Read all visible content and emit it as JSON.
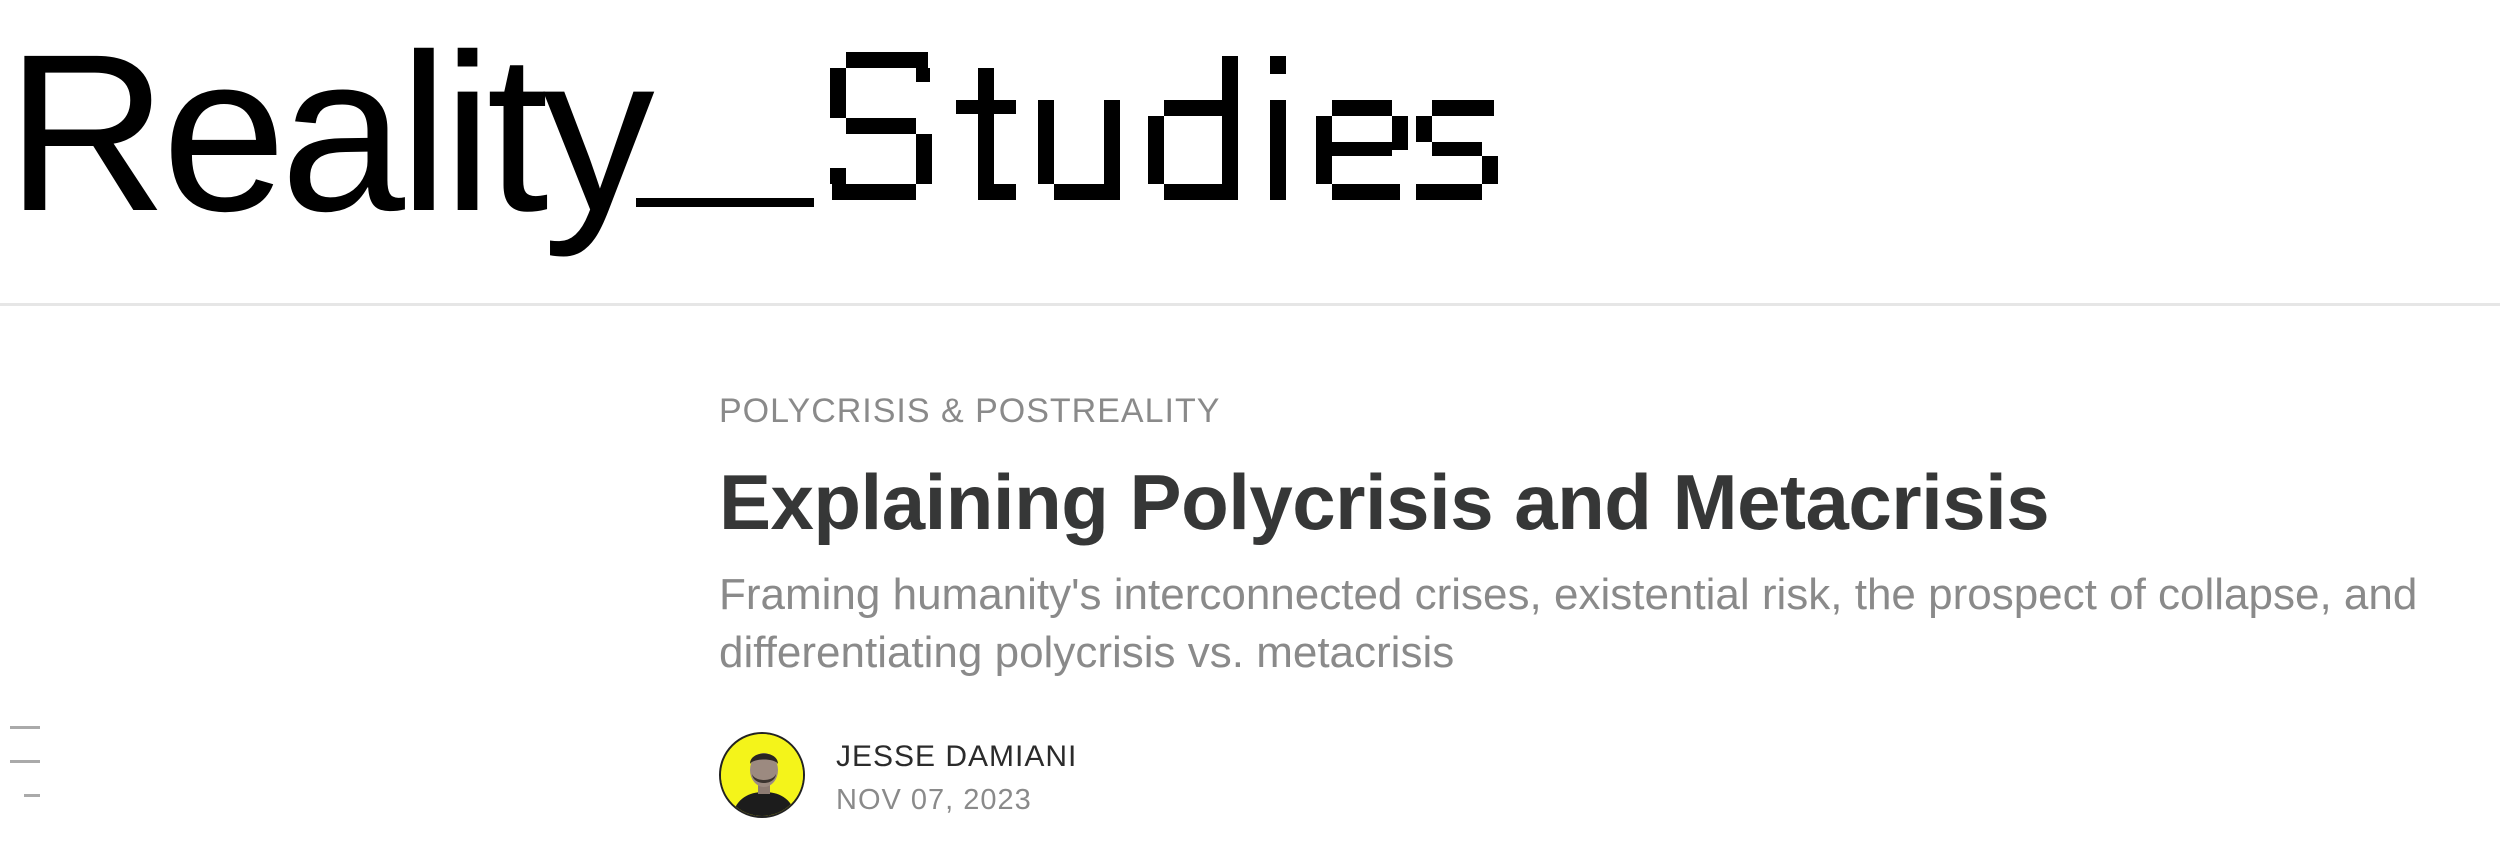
{
  "header": {
    "logo_text": "Reality__Studies"
  },
  "post": {
    "section": "POLYCRISIS & POSTREALITY",
    "title": "Explaining Polycrisis and Metacrisis",
    "subtitle": "Framing humanity's interconnected crises, existential risk, the prospect of collapse, and differentiating polycrisis vs. metacrisis",
    "author": "JESSE DAMIANI",
    "date": "NOV 07, 2023"
  },
  "icons": {
    "toc": "table-of-contents-icon",
    "avatar": "author-avatar"
  },
  "colors": {
    "title": "#363737",
    "muted": "#8a8a8a",
    "avatar_bg": "#f4f41a"
  }
}
